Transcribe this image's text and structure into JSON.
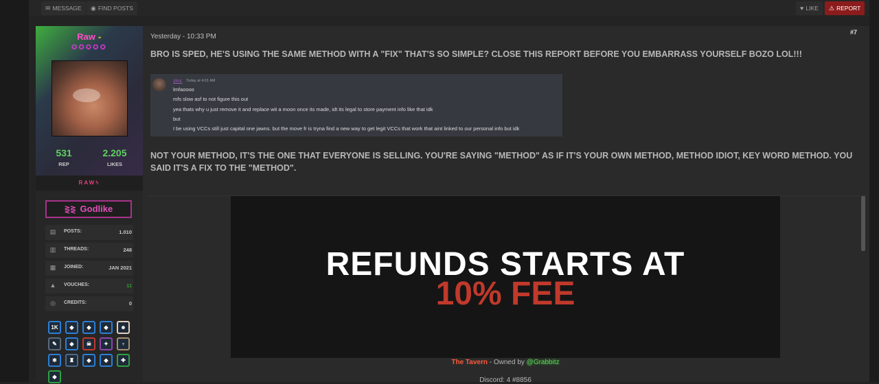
{
  "topbar": {
    "message_label": "MESSAGE",
    "find_posts_label": "FIND POSTS",
    "like_label": "LIKE",
    "report_label": "REPORT"
  },
  "profile": {
    "username": "Raw",
    "stars": "✪✪✪✪✪",
    "rep_value": "531",
    "rep_label": "REP",
    "likes_value": "2.205",
    "likes_label": "LIKES",
    "tag": "RAW",
    "rank": "Godlike",
    "info": [
      {
        "label": "POSTS:",
        "value": "1.010",
        "icon": "comments-icon"
      },
      {
        "label": "THREADS:",
        "value": "248",
        "icon": "book-icon"
      },
      {
        "label": "JOINED:",
        "value": "JAN 2021",
        "icon": "calendar-icon"
      },
      {
        "label": "VOUCHES:",
        "value": "11",
        "icon": "thumbs-up-icon"
      },
      {
        "label": "CREDITS:",
        "value": "0",
        "icon": "coins-icon"
      }
    ],
    "badges": [
      {
        "text": "1K",
        "color": "#2b7fd6"
      }
    ],
    "colors": {
      "vouches_value": "#2fa02f",
      "accent": "#ff4fc8"
    }
  },
  "post": {
    "date": "Yesterday - 10:33 PM",
    "number": "#7",
    "paragraph1": "BRO IS SPED, HE'S USING THE SAME METHOD WITH A \"FIX\" THAT'S SO SIMPLE? CLOSE THIS REPORT BEFORE YOU EMBARRASS YOURSELF BOZO LOL!!!",
    "paragraph2": "NOT YOUR METHOD, IT'S THE ONE THAT EVERYONE IS SELLING. YOU'RE SAYING \"METHOD\" AS IF IT'S YOUR OWN METHOD, METHOD IDIOT, KEY WORD METHOD. YOU SAID IT'S A FIX TO THE \"METHOD\".",
    "discord": {
      "name": "zinc",
      "time": "Today at 4:01 AM",
      "lines": [
        "lmfaoooo",
        "mfs slow asf to not figure this out",
        "yea thats why u just remove it and replace wit a moon once its made, idt its legal to store payment info like that idk",
        "but",
        "I be using VCCs still just capital one jawns. but the move fr is tryna find a new way to get legit VCCs that work that aint linked to our personal info but idk"
      ]
    }
  },
  "signature": {
    "banner_line1": "REFUNDS STARTS AT",
    "banner_line2": "10% FEE",
    "footer_tavern": "The Tavern",
    "footer_owned": " - Owned by ",
    "footer_owner": "@Grabbitz",
    "footer2": "Discord: 4 #8856"
  }
}
